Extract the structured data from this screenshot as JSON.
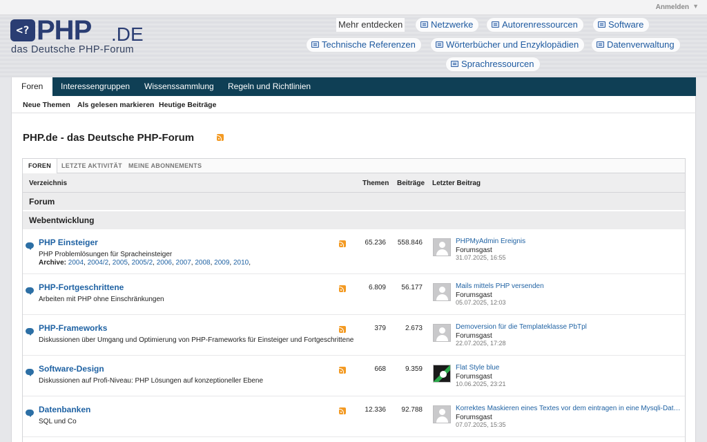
{
  "topbar": {
    "login": "Anmelden"
  },
  "logo": {
    "badge": "<?",
    "php": "PHP",
    "de": ".DE",
    "tagline": "das Deutsche PHP-Forum"
  },
  "external_links": {
    "discover": "Mehr entdecken",
    "networks": "Netzwerke",
    "author_resources": "Autorenressourcen",
    "software": "Software",
    "tech_refs": "Technische Referenzen",
    "dictionaries": "Wörterbücher und Enzyklopädien",
    "data_management": "Datenverwaltung",
    "language_resources": "Sprachressourcen"
  },
  "nav": {
    "tabs": [
      "Foren",
      "Interessengruppen",
      "Wissenssammlung",
      "Regeln und Richtlinien"
    ],
    "sub": [
      "Neue Themen",
      "Als gelesen markieren",
      "Heutige Beiträge"
    ]
  },
  "page_title": "PHP.de - das Deutsche PHP-Forum",
  "forum_tabs": [
    "FOREN",
    "LETZTE AKTIVITÄT",
    "MEINE ABONNEMENTS"
  ],
  "columns": {
    "dir": "Verzeichnis",
    "threads": "Themen",
    "posts": "Beiträge",
    "last": "Letzter Beitrag"
  },
  "sections": {
    "forum": "Forum",
    "webdev": "Webentwicklung"
  },
  "forums": [
    {
      "title": "PHP Einsteiger",
      "desc": "PHP Problemlösungen für Spracheinsteiger",
      "archive_label": "Archive:",
      "archive": [
        "2004",
        "2004/2",
        "2005",
        "2005/2",
        "2006",
        "2007",
        "2008",
        "2009",
        "2010"
      ],
      "threads": "65.236",
      "posts": "558.846",
      "last_title": "PHPMyAdmin Ereignis",
      "last_user": "Forumsgast",
      "last_date": "31.07.2025, 16:55"
    },
    {
      "title": "PHP-Fortgeschrittene",
      "desc": "Arbeiten mit PHP ohne Einschränkungen",
      "threads": "6.809",
      "posts": "56.177",
      "last_title": "Mails mittels PHP versenden",
      "last_user": "Forumsgast",
      "last_date": "05.07.2025, 12:03"
    },
    {
      "title": "PHP-Frameworks",
      "desc": "Diskussionen über Umgang und Optimierung von PHP-Frameworks für Einsteiger und Fortgeschrittene",
      "threads": "379",
      "posts": "2.673",
      "last_title": "Demoversion für die Templateklasse PbTpl",
      "last_user": "Forumsgast",
      "last_date": "22.07.2025, 17:28"
    },
    {
      "title": "Software-Design",
      "desc": "Diskussionen auf Profi-Niveau: PHP Lösungen auf konzeptioneller Ebene",
      "threads": "668",
      "posts": "9.359",
      "last_title": "Flat Style blue",
      "last_user": "Forumsgast",
      "last_date": "10.06.2025, 23:21"
    },
    {
      "title": "Datenbanken",
      "desc": "SQL und Co",
      "threads": "12.336",
      "posts": "92.788",
      "last_title": "Korrektes Maskieren eines Textes vor dem eintragen in eine Mysqli-Datenb…",
      "last_user": "Forumsgast",
      "last_date": "07.07.2025, 15:35"
    }
  ],
  "colors": {
    "nav_bg": "#0f3f55",
    "link": "#1f62a3",
    "logo": "#2a3d73",
    "rss": "#f39a23"
  }
}
